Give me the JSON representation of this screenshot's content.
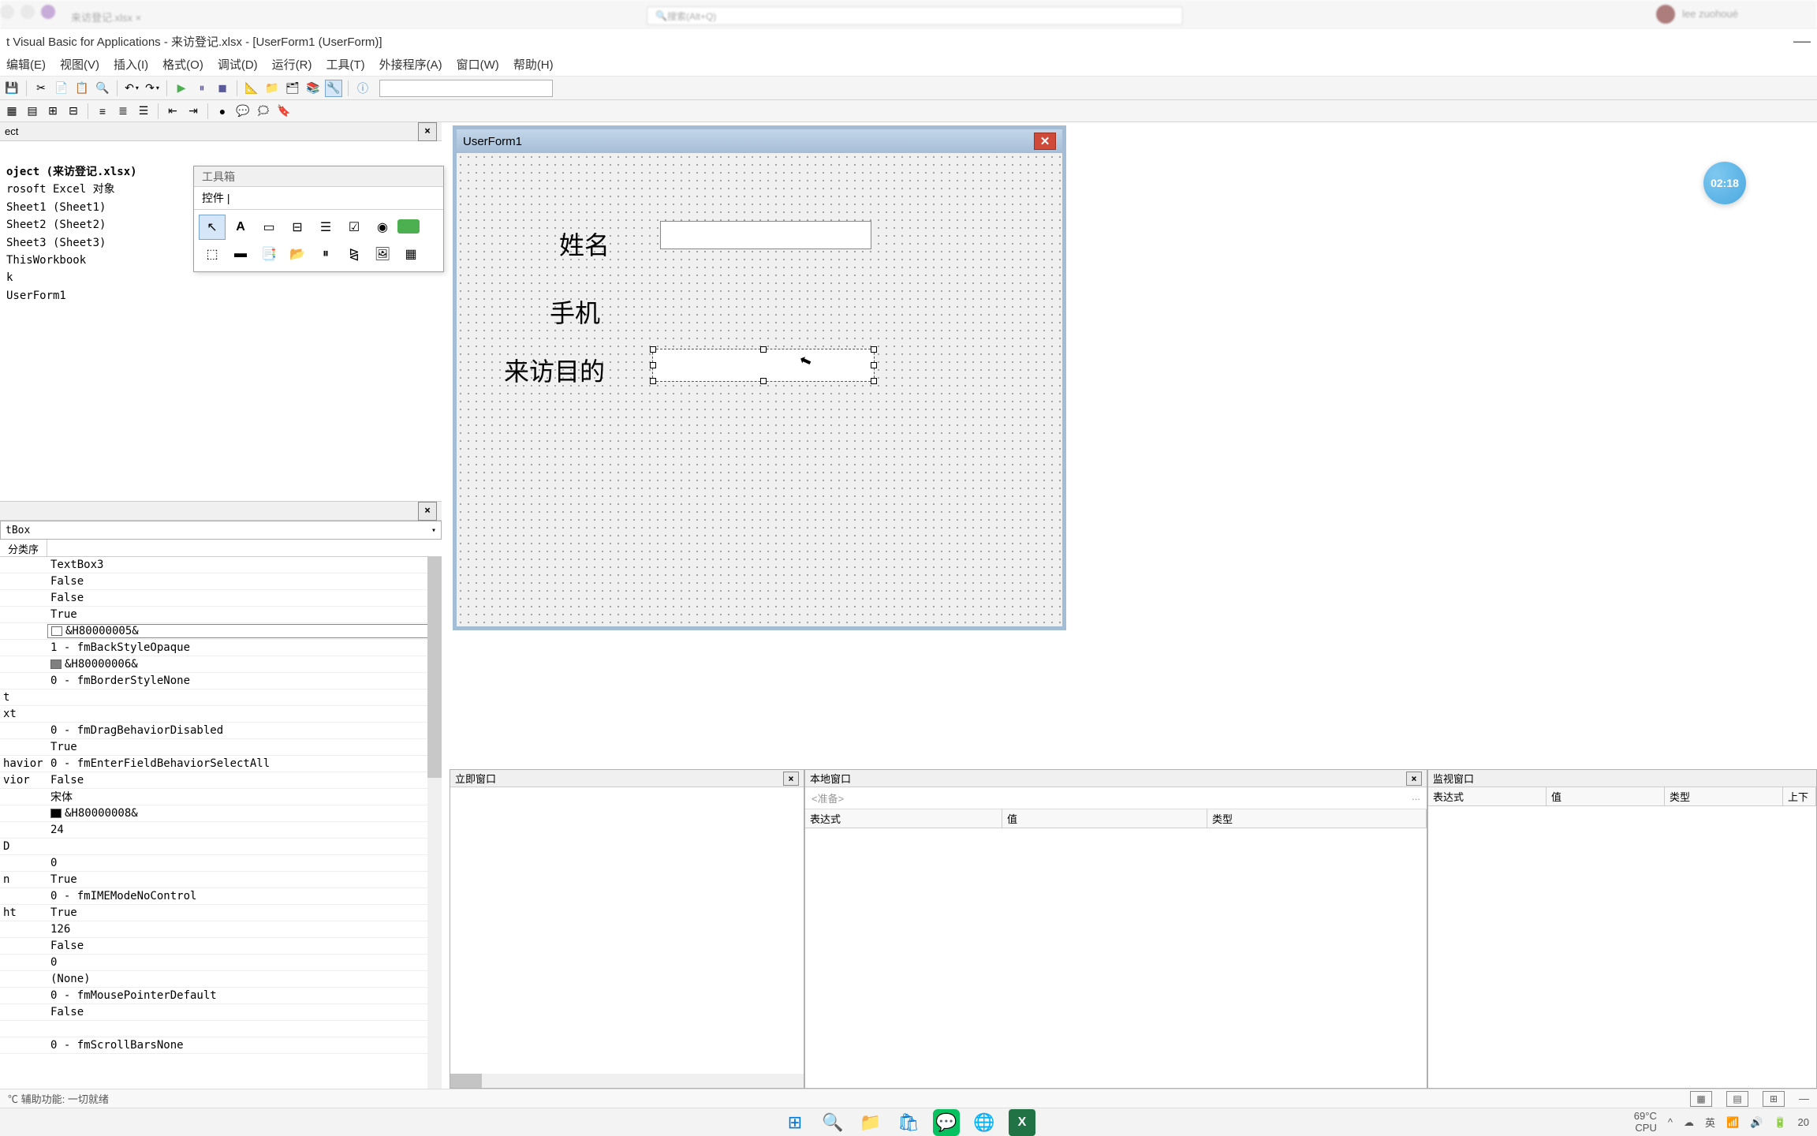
{
  "excel_top": {
    "tab": "来访登记.xlsx ×",
    "search": "搜索(Alt+Q)",
    "user": "lee zuohoué"
  },
  "title": "t Visual Basic for Applications - 来访登记.xlsx - [UserForm1 (UserForm)]",
  "menu": [
    "编辑(E)",
    "视图(V)",
    "插入(I)",
    "格式(O)",
    "调试(D)",
    "运行(R)",
    "工具(T)",
    "外接程序(A)",
    "窗口(W)",
    "帮助(H)"
  ],
  "project": {
    "title": "ect",
    "root": "oject (来访登记.xlsx)",
    "folder": "rosoft Excel 对象",
    "sheets": [
      "Sheet1 (Sheet1)",
      "Sheet2 (Sheet2)",
      "Sheet3 (Sheet3)",
      "ThisWorkbook"
    ],
    "last": "k",
    "form": "UserForm1"
  },
  "toolbox": {
    "title": "工具箱",
    "tab": "控件"
  },
  "props": {
    "object": "tBox",
    "tab1": "分类序",
    "rows": [
      {
        "n": "",
        "v": "TextBox3"
      },
      {
        "n": "",
        "v": "False"
      },
      {
        "n": "",
        "v": "False"
      },
      {
        "n": "",
        "v": "True"
      },
      {
        "n": "",
        "v": "&H80000005&",
        "swatch": "#ffffff",
        "dd": true
      },
      {
        "n": "",
        "v": "1 - fmBackStyleOpaque"
      },
      {
        "n": "",
        "v": "&H80000006&",
        "swatch": "#808080"
      },
      {
        "n": "",
        "v": "0 - fmBorderStyleNone"
      },
      {
        "n": "t",
        "v": ""
      },
      {
        "n": "xt",
        "v": ""
      },
      {
        "n": "",
        "v": "0 - fmDragBehaviorDisabled"
      },
      {
        "n": "",
        "v": "True"
      },
      {
        "n": "havior",
        "v": "0 - fmEnterFieldBehaviorSelectAll"
      },
      {
        "n": "vior",
        "v": "False"
      },
      {
        "n": "",
        "v": "宋体"
      },
      {
        "n": "",
        "v": "&H80000008&",
        "swatch": "#000000"
      },
      {
        "n": "",
        "v": "24"
      },
      {
        "n": "D",
        "v": ""
      },
      {
        "n": "",
        "v": "0"
      },
      {
        "n": "n",
        "v": "True"
      },
      {
        "n": "",
        "v": "0 - fmIMEModeNoControl"
      },
      {
        "n": "ht",
        "v": "True"
      },
      {
        "n": "",
        "v": "126"
      },
      {
        "n": "",
        "v": "False"
      },
      {
        "n": "",
        "v": "0"
      },
      {
        "n": "",
        "v": "(None)"
      },
      {
        "n": "",
        "v": "0 - fmMousePointerDefault"
      },
      {
        "n": "",
        "v": "False"
      },
      {
        "n": "",
        "v": ""
      },
      {
        "n": "",
        "v": "0 - fmScrollBarsNone"
      }
    ]
  },
  "form": {
    "title": "UserForm1",
    "labels": {
      "name": "姓名",
      "phone": "手机",
      "purpose": "来访目的"
    }
  },
  "immediate": {
    "title": "立即窗口"
  },
  "locals": {
    "title": "本地窗口",
    "ready": "<准备>",
    "cols": [
      "表达式",
      "值",
      "类型"
    ]
  },
  "watch": {
    "title": "监视窗口",
    "cols": [
      "表达式",
      "值",
      "类型",
      "上下"
    ]
  },
  "status": {
    "left": "℃ 辅助功能: 一切就绪"
  },
  "badge": "02:18",
  "tray": {
    "temp": "69°C",
    "cpu": "CPU",
    "time": "20"
  }
}
